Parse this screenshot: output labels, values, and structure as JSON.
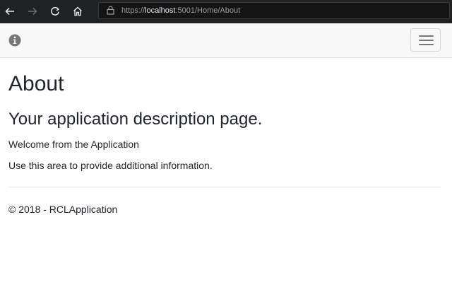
{
  "browser": {
    "back_icon": "arrow-left-icon",
    "forward_icon": "arrow-right-icon",
    "refresh_icon": "refresh-icon",
    "home_icon": "home-icon",
    "lock_icon": "lock-icon",
    "url_scheme": "https://",
    "url_host": "localhost",
    "url_rest": ":5001/Home/About"
  },
  "navbar": {
    "brand_icon": "info-icon",
    "toggle_icon": "hamburger-menu-icon"
  },
  "main": {
    "title": "About",
    "subtitle": "Your application description page.",
    "welcome": "Welcome from the Application",
    "info": "Use this area to provide additional information."
  },
  "footer": {
    "text": "© 2018 - RCLApplication"
  },
  "colors": {
    "browser_chrome": "#202124",
    "navbar_bg": "#f8f8f8",
    "text": "#212529"
  }
}
